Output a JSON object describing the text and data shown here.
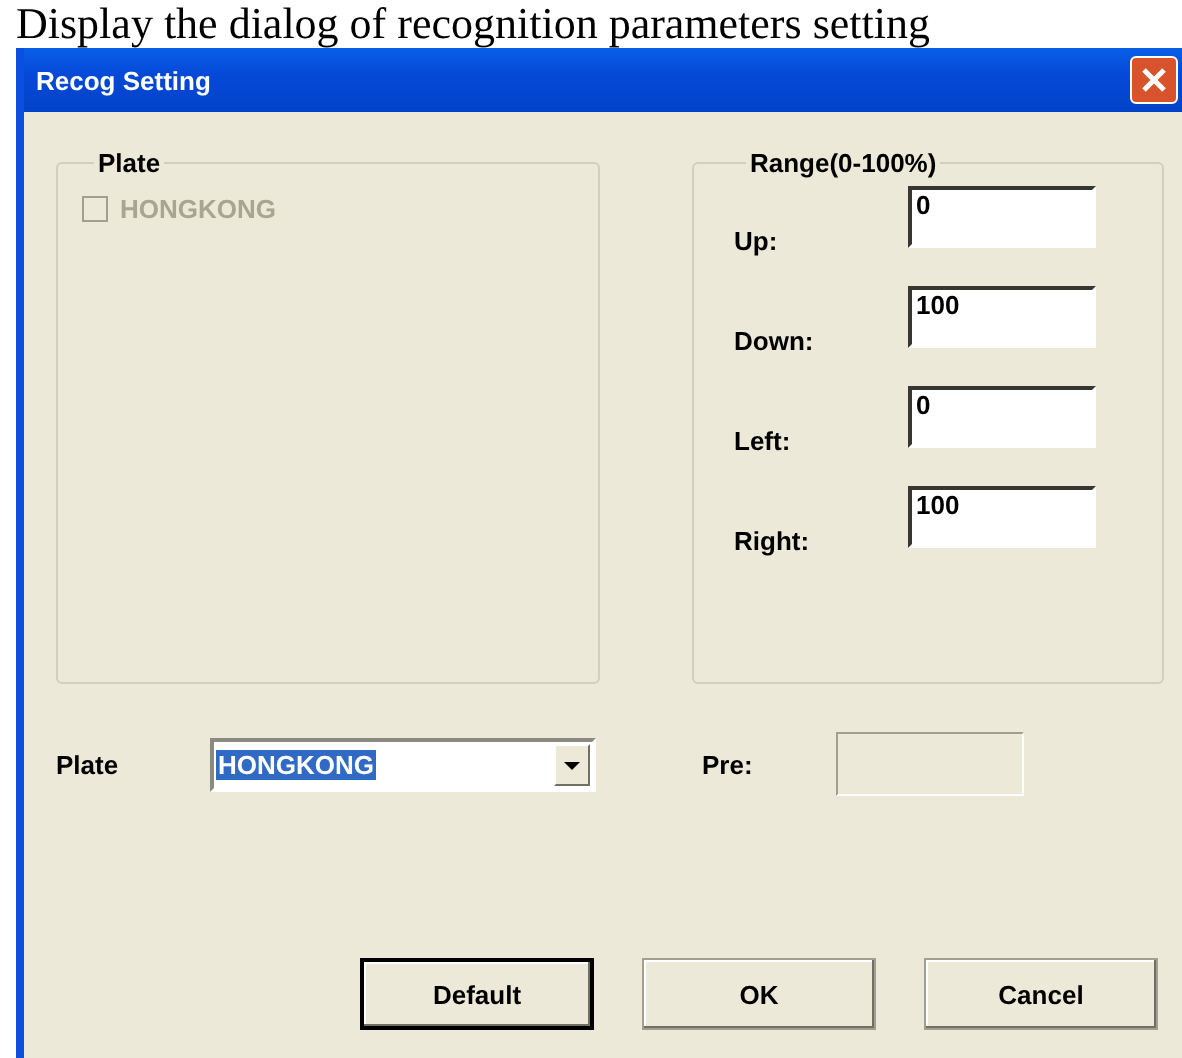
{
  "caption": "Display the dialog of recognition parameters setting",
  "window": {
    "title": "Recog Setting"
  },
  "plate_group": {
    "title": "Plate",
    "checkbox": {
      "label": "HONGKONG",
      "checked": false,
      "disabled": true
    }
  },
  "range_group": {
    "title": "Range(0-100%)",
    "fields": [
      {
        "label": "Up:",
        "value": "0"
      },
      {
        "label": "Down:",
        "value": "100"
      },
      {
        "label": "Left:",
        "value": "0"
      },
      {
        "label": "Right:",
        "value": "100"
      }
    ]
  },
  "plate_select": {
    "label": "Plate",
    "value": "HONGKONG"
  },
  "pre": {
    "label": "Pre:",
    "disabled": true
  },
  "buttons": [
    {
      "label": "Default",
      "focused": true
    },
    {
      "label": "OK",
      "focused": false
    },
    {
      "label": "Cancel",
      "focused": false
    }
  ]
}
